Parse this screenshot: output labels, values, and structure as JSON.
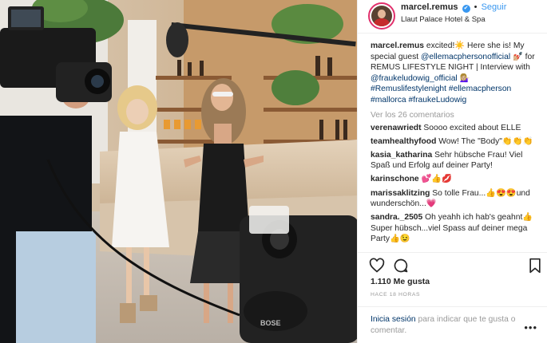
{
  "post": {
    "username": "marcel.remus",
    "verified_glyph": "✔",
    "separator": "•",
    "follow_label": "Seguir",
    "location": "Llaut Palace Hotel & Spa",
    "avatar_icon": "profile-avatar"
  },
  "photo": {
    "camera_brand": "BOSE",
    "scene": "two women interviewed by camera crew at hotel bar"
  },
  "caption": {
    "username": "marcel.remus",
    "text_1": "excited!☀️ Here she is! My special guest ",
    "mention_1": "@ellemacphersonofficial",
    "text_2": " 💅🏼 for REMUS LIFESTYLE NIGHT | Interview with ",
    "mention_2": "@fraukeludowig_official",
    "text_3": " 💁🏼‍♀️ ",
    "hashtags": "#Remuslifestylenight #ellemacpherson #mallorca #fraukeLudowig"
  },
  "view_all_label": "Ver los 26 comentarios",
  "comments": [
    {
      "user": "verenawriedt",
      "text": "Soooo excited about ELLE"
    },
    {
      "user": "teamhealthyfood",
      "text": "Wow! The \"Body\"👏👏👏"
    },
    {
      "user": "kasia_katharina",
      "text": "Sehr hübsche Frau! Viel Spaß und Erfolg auf deiner Party!"
    },
    {
      "user": "karinschone",
      "text": "💕👍💋"
    },
    {
      "user": "marissaklitzing",
      "text": "So tolle Frau...👍😍😍und wunderschön...💗"
    },
    {
      "user": "sandra._2505",
      "text": "Oh yeahh ich hab's geahnt👍 Super hübsch...viel Spass auf deiner mega Party👍😉"
    }
  ],
  "actions": {
    "like_icon": "heart-icon",
    "comment_icon": "comment-icon",
    "save_icon": "bookmark-icon"
  },
  "likes_label": "1.110 Me gusta",
  "timestamp": "HACE 18 HORAS",
  "login_prompt": {
    "link": "Inicia sesión",
    "text": " para indicar que te gusta o comentar."
  },
  "more_options": "•••",
  "colors": {
    "link_blue": "#3897f0",
    "mention_navy": "#003569",
    "muted_gray": "#999999",
    "text": "#262626",
    "border": "#efefef"
  }
}
